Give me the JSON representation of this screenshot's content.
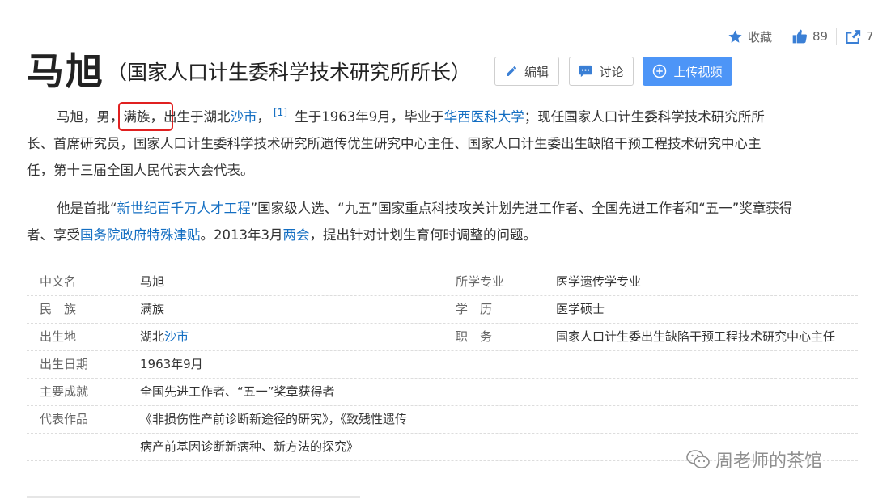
{
  "stats": {
    "collect_label": "收藏",
    "like_count": "89",
    "share_count": "7"
  },
  "title": {
    "name": "马旭",
    "subtitle": "（国家人口计生委科学技术研究所所长）"
  },
  "buttons": {
    "edit": "编辑",
    "discuss": "讨论",
    "upload_video": "上传视频"
  },
  "intro": {
    "p1_seg1": "马旭，男，",
    "p1_ethnic": "满族，",
    "p1_seg2": "出生于湖北",
    "p1_link_city": "沙市",
    "p1_seg3": "，",
    "p1_ref": "[1]",
    "p1_seg4": " 生于1963年9月，毕业于",
    "p1_link_school": "华西医科大学",
    "p1_seg5": "；现任国家人口计生委科学技术研究所所",
    "p1_line2": "长、首席研究员，国家人口计生委科学技术研究所遗传优生研究中心主任、国家人口计生委出生缺陷干预工程技术研究中心主",
    "p1_line3": "任，第十三届全国人民代表大会代表。",
    "p2_seg1": "他是首批“",
    "p2_link1": "新世纪百千万人才工程",
    "p2_seg2": "”国家级人选、“九五”国家重点科技攻关计划先进工作者、全国先进工作者和“五一”奖章获得",
    "p2_seg3": "者、享受",
    "p2_link2": "国务院政府特殊津贴",
    "p2_seg4": "。2013年3月",
    "p2_link3": "两会",
    "p2_seg5": "，提出针对计划生育何时调整的问题。"
  },
  "info_table": {
    "r1": {
      "k1": "中文名",
      "v1": "马旭",
      "k2": "所学专业",
      "v2": "医学遗传学专业"
    },
    "r2": {
      "k1": "民　族",
      "v1": "满族",
      "k2": "学　历",
      "v2": "医学硕士"
    },
    "r3": {
      "k1": "出生地",
      "v1_prefix": "湖北",
      "v1_link": "沙市",
      "k2": "职　务",
      "v2": "国家人口计生委出生缺陷干预工程技术研究中心主任"
    },
    "r4": {
      "k1": "出生日期",
      "v1": "1963年9月"
    },
    "r5": {
      "k1": "主要成就",
      "v1": "全国先进工作者、“五一”奖章获得者"
    },
    "r6": {
      "k1": "代表作品",
      "v1": "《非损伤性产前诊断新途径的研究》，《致残性遗传"
    },
    "r7": {
      "v1": "病产前基因诊断新病种、新方法的探究》"
    }
  },
  "watermark": {
    "text": "周老师的茶馆"
  },
  "colors": {
    "link": "#136ec2",
    "primary_button": "#4d95f7",
    "highlight_box": "#e02020"
  }
}
